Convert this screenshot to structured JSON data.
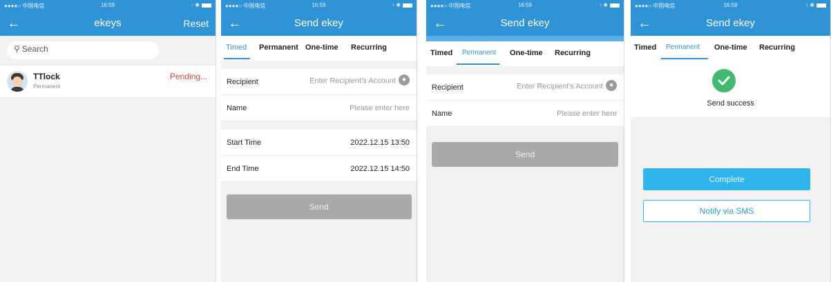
{
  "status": {
    "carrier": "●●●●○ 中国电信 ",
    "time": "16:59",
    "right": "↑ ✱"
  },
  "screen1": {
    "title": "ekeys",
    "reset": "Reset",
    "search_placeholder": "Search",
    "item": {
      "name": "TTlock",
      "type": "Permanent",
      "status": "Pending..."
    }
  },
  "send": {
    "title": "Send ekey",
    "tabs": [
      "Timed",
      "Permanent",
      "One-time",
      "Recurring"
    ],
    "recipient_label": "Recipient",
    "recipient_placeholder": "Enter Recipient's Account",
    "name_label": "Name",
    "name_placeholder": "Please enter here",
    "start_label": "Start Time",
    "start_value": "2022.12.15 13:50",
    "end_label": "End Time",
    "end_value": "2022.12.15 14:50",
    "send_button": "Send"
  },
  "success": {
    "text": "Send success",
    "complete": "Complete",
    "sms": "Notify via SMS"
  },
  "colors": {
    "header": "#2f93d8",
    "accent": "#2f93d8",
    "pending": "#e0463c",
    "success": "#43b96d",
    "complete": "#2fb3e8"
  }
}
